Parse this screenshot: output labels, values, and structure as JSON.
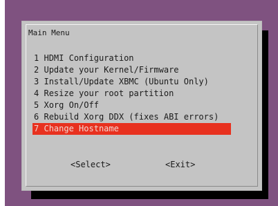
{
  "dialog": {
    "title": "Main Menu"
  },
  "menu": {
    "items": [
      {
        "num": "1",
        "label": "HDMI Configuration"
      },
      {
        "num": "2",
        "label": "Update your Kernel/Firmware"
      },
      {
        "num": "3",
        "label": "Install/Update XBMC (Ubuntu Only)"
      },
      {
        "num": "4",
        "label": "Resize your root partition"
      },
      {
        "num": "5",
        "label": "Xorg On/Off"
      },
      {
        "num": "6",
        "label": "Rebuild Xorg DDX (fixes ABI errors)"
      },
      {
        "num": "7",
        "label": "Change Hostname"
      }
    ],
    "selected_index": 6
  },
  "buttons": {
    "select_label": "<Select>",
    "exit_label": "<Exit>"
  },
  "colors": {
    "terminal_background": "#7f5280",
    "dialog_background": "#c4c4c4",
    "selection_highlight": "#e8311f",
    "shadow": "#000000"
  }
}
